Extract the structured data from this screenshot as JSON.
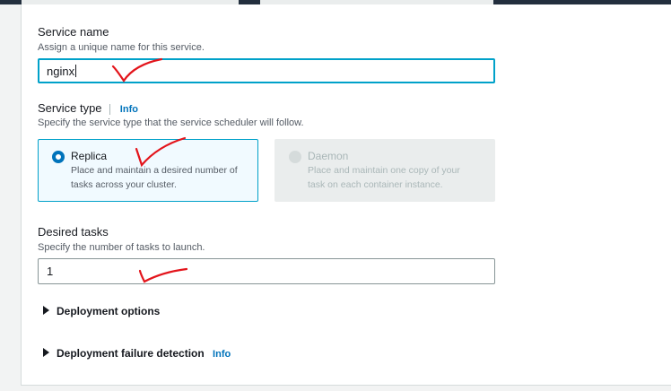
{
  "service_name": {
    "label": "Service name",
    "description": "Assign a unique name for this service.",
    "value": "nginx"
  },
  "service_type": {
    "label": "Service type",
    "info": "Info",
    "description": "Specify the service type that the service scheduler will follow.",
    "options": [
      {
        "title": "Replica",
        "desc_line1": "Place and maintain a desired number of",
        "desc_line2": "tasks across your cluster.",
        "selected": true,
        "disabled": false
      },
      {
        "title": "Daemon",
        "desc_line1": "Place and maintain one copy of your",
        "desc_line2": "task on each container instance.",
        "selected": false,
        "disabled": true
      }
    ]
  },
  "desired_tasks": {
    "label": "Desired tasks",
    "description": "Specify the number of tasks to launch.",
    "value": "1"
  },
  "expanders": {
    "deployment_options": "Deployment options",
    "deployment_failure_detection": "Deployment failure detection",
    "failure_info": "Info"
  },
  "colors": {
    "accent": "#0073bb",
    "focus": "#00a1c9",
    "annotation": "#e3141b"
  }
}
